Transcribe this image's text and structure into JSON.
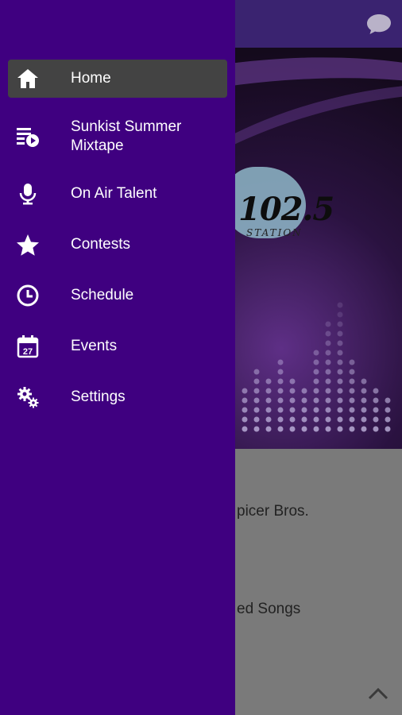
{
  "background": {
    "logo_text": "102.5",
    "logo_subtext": "STATION",
    "rows": [
      "picer Bros.",
      "ed Songs"
    ]
  },
  "drawer": {
    "items": [
      {
        "label": "Home",
        "icon": "home-icon",
        "active": true
      },
      {
        "label": "Sunkist Summer\nMixtape",
        "icon": "playlist-play-icon",
        "active": false
      },
      {
        "label": "On Air Talent",
        "icon": "microphone-icon",
        "active": false
      },
      {
        "label": "Contests",
        "icon": "star-icon",
        "active": false
      },
      {
        "label": "Schedule",
        "icon": "clock-icon",
        "active": false
      },
      {
        "label": "Events",
        "icon": "calendar-icon",
        "active": false
      },
      {
        "label": "Settings",
        "icon": "gears-icon",
        "active": false
      }
    ],
    "calendar_day": "27"
  },
  "colors": {
    "drawer_bg": "#3f0080",
    "active_item_bg": "#434343",
    "topbar_bg": "#3a2370",
    "content_bg": "#7a7a7a"
  }
}
